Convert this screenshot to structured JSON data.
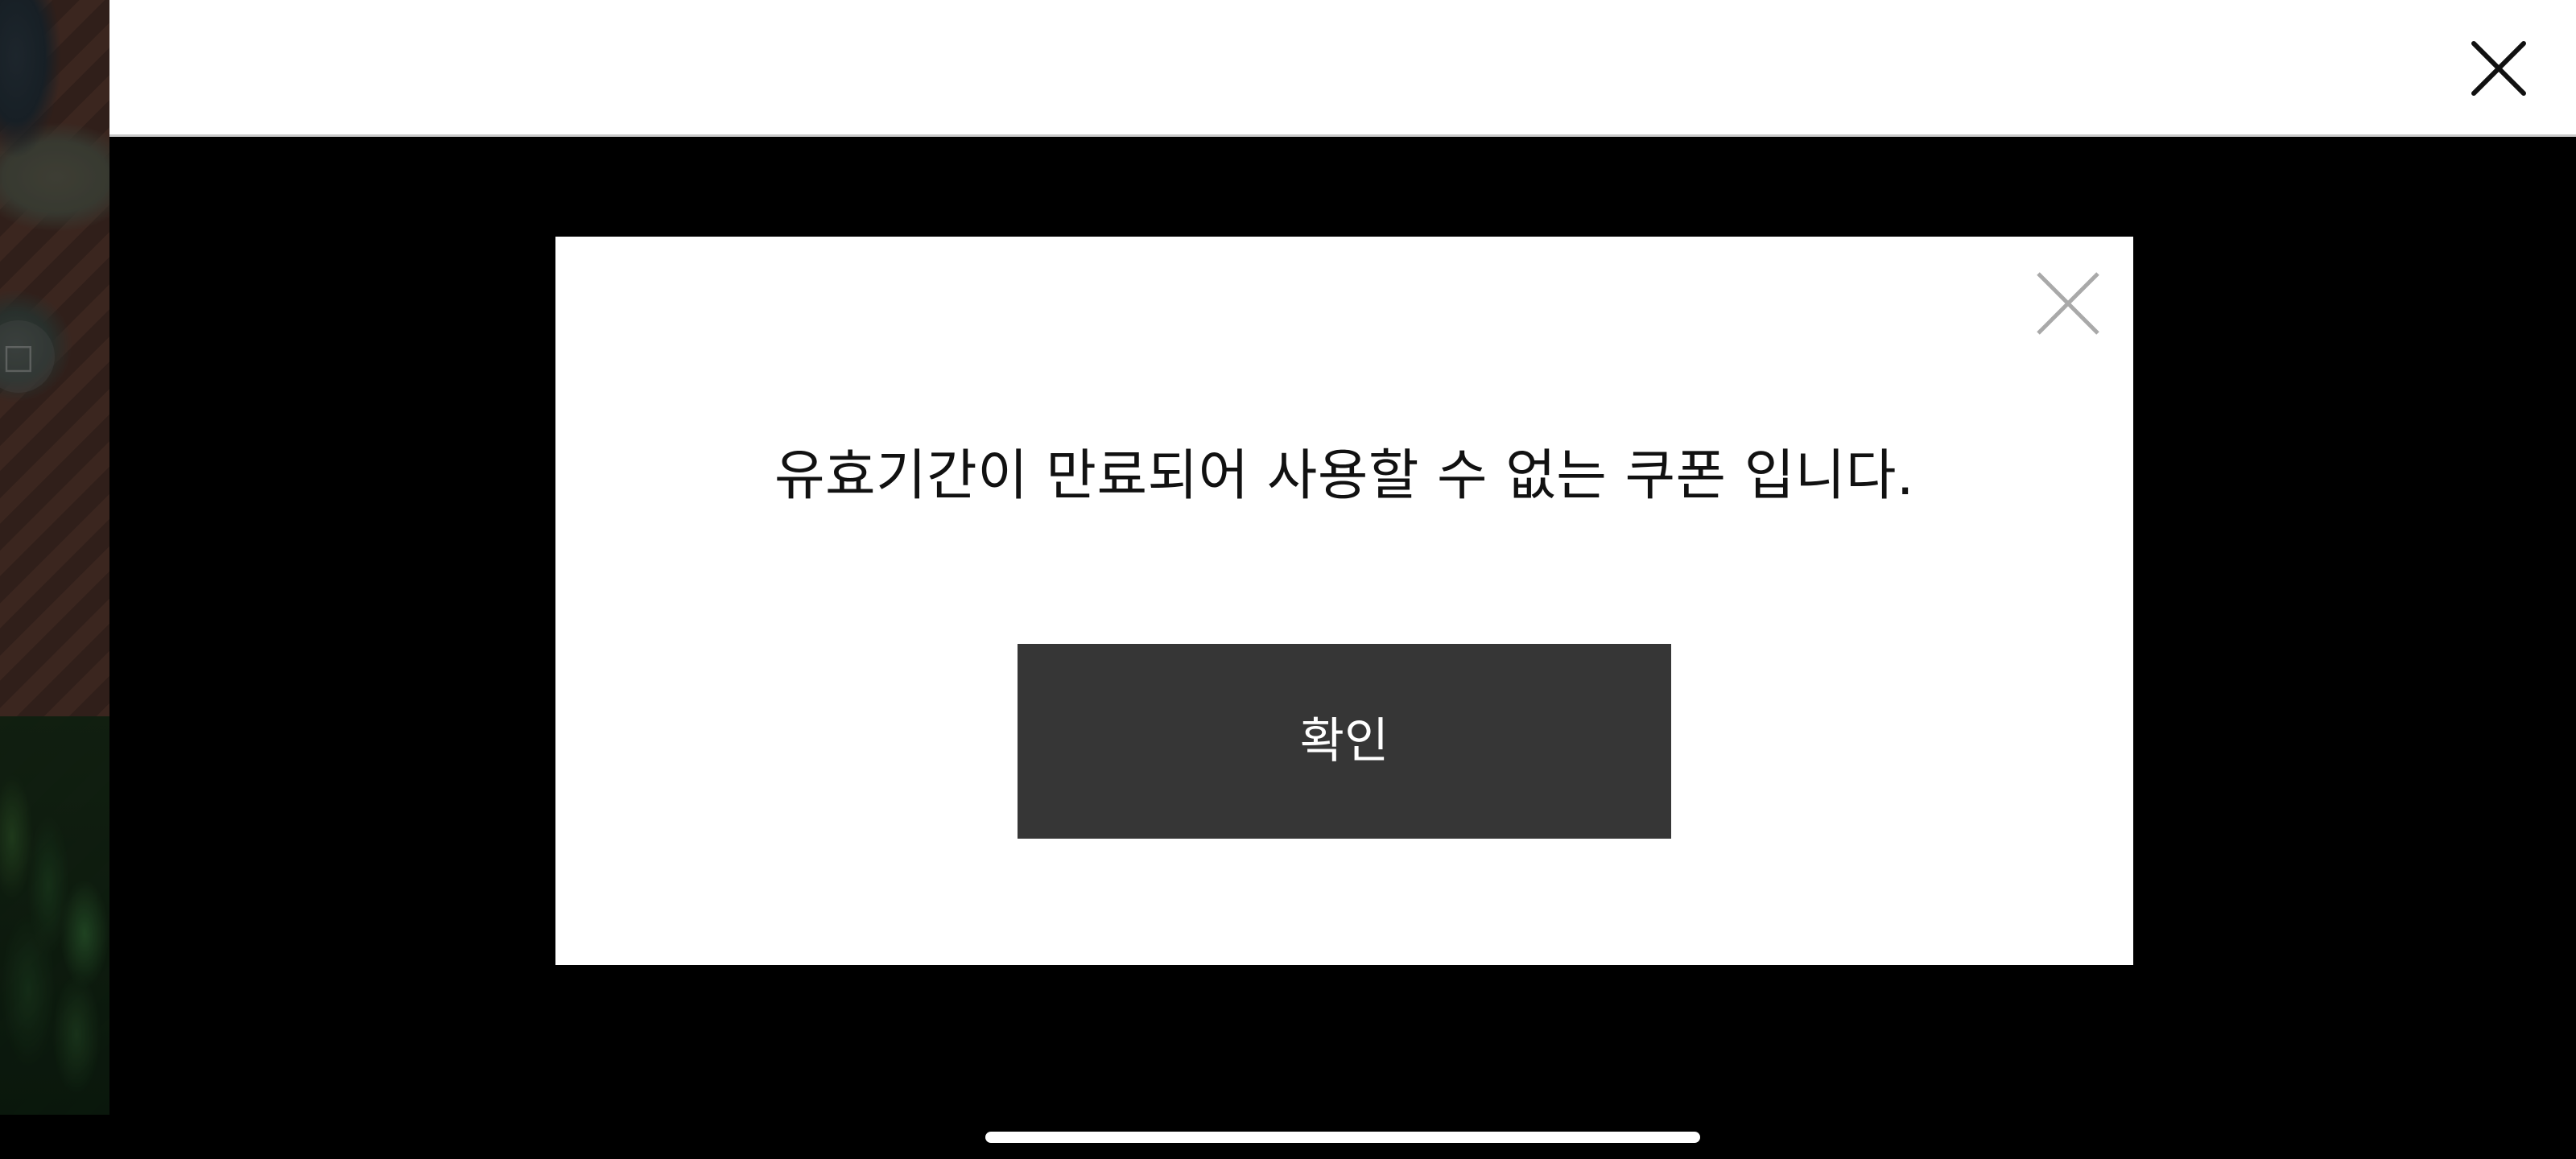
{
  "app": {
    "background_strip": {
      "icon": "square-outline-icon"
    }
  },
  "header": {
    "close_icon": "close-icon"
  },
  "dialog": {
    "message": "유효기간이 만료되어 사용할 수 없는 쿠폰 입니다.",
    "close_icon": "close-icon",
    "confirm_label": "확인"
  },
  "colors": {
    "page_background": "#000000",
    "header_background": "#ffffff",
    "dialog_background": "#ffffff",
    "confirm_button_background": "#363636",
    "confirm_button_text": "#ffffff",
    "message_text": "#111111",
    "dialog_close_icon": "#a9a9a9",
    "header_close_icon": "#111111",
    "home_indicator": "#ffffff"
  }
}
